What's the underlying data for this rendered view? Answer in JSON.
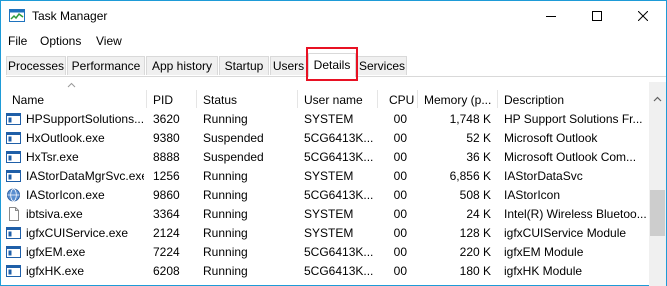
{
  "window": {
    "title": "Task Manager"
  },
  "menu": [
    "File",
    "Options",
    "View"
  ],
  "tabs": [
    "Processes",
    "Performance",
    "App history",
    "Startup",
    "Users",
    "Details",
    "Services"
  ],
  "columns": [
    "Name",
    "PID",
    "Status",
    "User name",
    "CPU",
    "Memory (p...",
    "Description"
  ],
  "rows": [
    {
      "name": "HPSupportSolutions...",
      "pid": "3620",
      "status": "Running",
      "user": "SYSTEM",
      "cpu": "00",
      "mem": "1,748 K",
      "desc": "HP Support Solutions Fr...",
      "icon": "app-icon"
    },
    {
      "name": "HxOutlook.exe",
      "pid": "9380",
      "status": "Suspended",
      "user": "5CG6413K...",
      "cpu": "00",
      "mem": "52 K",
      "desc": "Microsoft Outlook",
      "icon": "app-icon"
    },
    {
      "name": "HxTsr.exe",
      "pid": "8888",
      "status": "Suspended",
      "user": "5CG6413K...",
      "cpu": "00",
      "mem": "36 K",
      "desc": "Microsoft Outlook Com...",
      "icon": "app-icon"
    },
    {
      "name": "IAStorDataMgrSvc.exe",
      "pid": "1256",
      "status": "Running",
      "user": "SYSTEM",
      "cpu": "00",
      "mem": "6,856 K",
      "desc": "IAStorDataSvc",
      "icon": "app-icon"
    },
    {
      "name": "IAStorIcon.exe",
      "pid": "9860",
      "status": "Running",
      "user": "5CG6413K...",
      "cpu": "00",
      "mem": "508 K",
      "desc": "IAStorIcon",
      "icon": "intel-globe-icon"
    },
    {
      "name": "ibtsiva.exe",
      "pid": "3364",
      "status": "Running",
      "user": "SYSTEM",
      "cpu": "00",
      "mem": "24 K",
      "desc": "Intel(R) Wireless Bluetoo...",
      "icon": "blank-file-icon"
    },
    {
      "name": "igfxCUIService.exe",
      "pid": "2124",
      "status": "Running",
      "user": "SYSTEM",
      "cpu": "00",
      "mem": "128 K",
      "desc": "igfxCUIService Module",
      "icon": "app-icon"
    },
    {
      "name": "igfxEM.exe",
      "pid": "7224",
      "status": "Running",
      "user": "5CG6413K...",
      "cpu": "00",
      "mem": "220 K",
      "desc": "igfxEM Module",
      "icon": "app-icon"
    },
    {
      "name": "igfxHK.exe",
      "pid": "6208",
      "status": "Running",
      "user": "5CG6413K...",
      "cpu": "00",
      "mem": "180 K",
      "desc": "igfxHK Module",
      "icon": "app-icon"
    }
  ]
}
